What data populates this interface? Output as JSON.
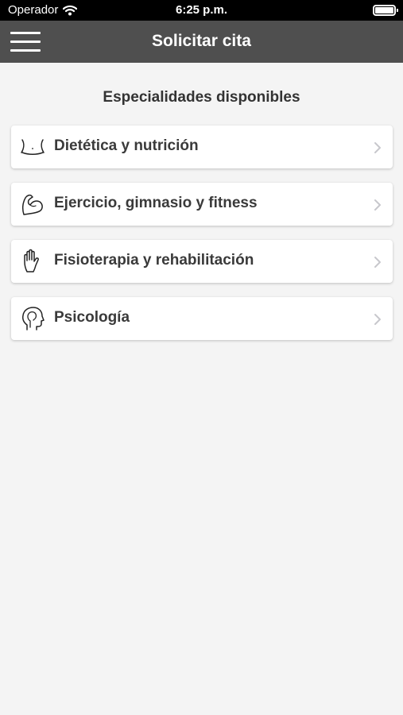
{
  "status_bar": {
    "carrier": "Operador",
    "time": "6:25 p.m."
  },
  "header": {
    "title": "Solicitar cita"
  },
  "main": {
    "section_title": "Especialidades disponibles",
    "specialties": [
      {
        "label": "Dietética y nutrición",
        "icon": "waist-icon"
      },
      {
        "label": "Ejercicio, gimnasio y fitness",
        "icon": "flexed-arm-icon"
      },
      {
        "label": "Fisioterapia y rehabilitación",
        "icon": "hand-icon"
      },
      {
        "label": "Psicología",
        "icon": "head-profile-icon"
      }
    ]
  },
  "colors": {
    "nav_background": "#4f4f4f",
    "page_background": "#f4f4f4",
    "card_background": "#ffffff"
  }
}
